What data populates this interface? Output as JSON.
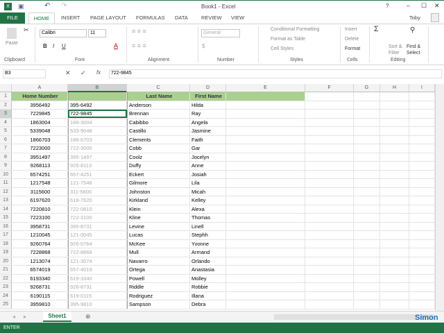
{
  "title": "Book1 - Excel",
  "user": "Toby",
  "tabs": [
    "FILE",
    "HOME",
    "INSERT",
    "PAGE LAYOUT",
    "FORMULAS",
    "DATA",
    "REVIEW",
    "VIEW"
  ],
  "ribbon": {
    "paste": "Paste",
    "font_name": "Calibri",
    "font_size": "11",
    "number_format": "General",
    "conditional": "Conditional Formatting",
    "format_table": "Format as Table",
    "cell_styles": "Cell Styles",
    "insert": "Insert",
    "delete": "Delete",
    "format": "Format",
    "sort": "Sort & Filter",
    "find": "Find & Select",
    "bold": "B",
    "italic": "I",
    "underline": "U",
    "groups": [
      "Clipboard",
      "Font",
      "Alignment",
      "Number",
      "Styles",
      "Cells",
      "Editing"
    ]
  },
  "formula_bar": {
    "name_box": "B3",
    "value": "722-9845",
    "fx": "fx"
  },
  "columns": [
    "A",
    "B",
    "C",
    "D",
    "E",
    "F",
    "G",
    "H",
    "I"
  ],
  "headers": [
    "Home Number",
    "",
    "Last Name",
    "First Name"
  ],
  "rows": [
    [
      "3956492",
      "395-6492",
      "Anderson",
      "Hilda"
    ],
    [
      "7229845",
      "722-9845",
      "Brennan",
      "Ray"
    ],
    [
      "1863004",
      "186-3004",
      "Cabibbo",
      "Angela"
    ],
    [
      "5339048",
      "533-9048",
      "Castillo",
      "Jasmine"
    ],
    [
      "1866703",
      "186-6703",
      "Clements",
      "Faith"
    ],
    [
      "7223000",
      "722-3000",
      "Cobb",
      "Gar"
    ],
    [
      "3951497",
      "395-1497",
      "Coolz",
      "Jocelyn"
    ],
    [
      "9268113",
      "926-8113",
      "Duffy",
      "Anne"
    ],
    [
      "6574251",
      "657-4251",
      "Eckert",
      "Josiah"
    ],
    [
      "1217548",
      "121-7548",
      "Gilmore",
      "Lila"
    ],
    [
      "3115600",
      "311-5600",
      "Johnston",
      "Micah"
    ],
    [
      "6197620",
      "619-7620",
      "Kirkland",
      "Kelley"
    ],
    [
      "7220810",
      "722-0810",
      "Klein",
      "Alexa"
    ],
    [
      "7223100",
      "722-3100",
      "Kline",
      "Thomas"
    ],
    [
      "3958731",
      "395-8731",
      "Levine",
      "Linell"
    ],
    [
      "1210045",
      "121-0045",
      "Lucas",
      "Stephh"
    ],
    [
      "9260764",
      "926-0764",
      "McKee",
      "Yvonne"
    ],
    [
      "7228868",
      "722-8868",
      "Mull",
      "Armand"
    ],
    [
      "1213074",
      "121-3074",
      "Navarro",
      "Orlando"
    ],
    [
      "6574019",
      "657-4019",
      "Ortega",
      "Anastasia"
    ],
    [
      "6193340",
      "619-3340",
      "Powell",
      "Molley"
    ],
    [
      "9268731",
      "926-8731",
      "Riddle",
      "Robbie"
    ],
    [
      "6190115",
      "619-0115",
      "Rodriguez",
      "Illana"
    ],
    [
      "3959810",
      "395-9810",
      "Sampson",
      "Debra"
    ]
  ],
  "sheet_tab": "Sheet1",
  "status": "ENTER",
  "watermark": "Simon"
}
